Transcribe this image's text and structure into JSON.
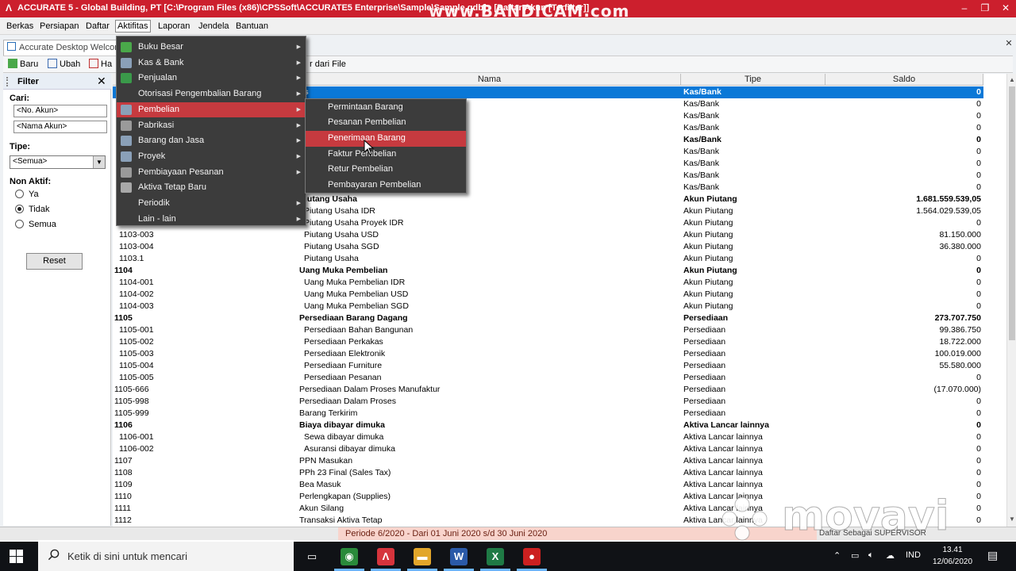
{
  "window": {
    "title": "ACCURATE 5 - Global Building, PT   [C:\\Program Files (x86)\\CPSSoft\\ACCURATE5 Enterprise\\Sample\\Sample.gdb] - [Daftar Akun [Terfilter]]",
    "recording_watermark": "www.BANDICAM.com",
    "minimize": "–",
    "restore": "❐",
    "close": "✕",
    "accent_color": "#cc1f2d"
  },
  "menubar": {
    "items": [
      "Berkas",
      "Persiapan",
      "Daftar",
      "Aktifitas",
      "Laporan",
      "Jendela",
      "Bantuan"
    ],
    "active": "Aktifitas"
  },
  "document_tab": {
    "label": "Accurate Desktop Welcome"
  },
  "toolbar": {
    "new_label": "Baru",
    "edit_label": "Ubah",
    "delete_label": "Ha",
    "import_label": "r dari File"
  },
  "filter": {
    "title": "Filter",
    "search_label": "Cari:",
    "account_no_placeholder": "<No. Akun>",
    "account_name_placeholder": "<Nama Akun>",
    "type_label": "Tipe:",
    "type_value": "<Semua>",
    "inactive_label": "Non Aktif:",
    "options": [
      "Ya",
      "Tidak",
      "Semua"
    ],
    "selected_option": "Tidak",
    "reset_label": "Reset"
  },
  "grid": {
    "columns": [
      "Nama",
      "Tipe",
      "Saldo"
    ],
    "rows": [
      {
        "no": "",
        "nama": "as",
        "tipe": "Kas/Bank",
        "saldo": "0",
        "bold": true,
        "selected": true,
        "sub": false
      },
      {
        "no": "",
        "nama": "",
        "tipe": "Kas/Bank",
        "saldo": "0",
        "bold": false,
        "selected": false,
        "sub": true
      },
      {
        "no": "",
        "nama": "",
        "tipe": "Kas/Bank",
        "saldo": "0",
        "bold": false,
        "selected": false,
        "sub": true
      },
      {
        "no": "",
        "nama": "",
        "tipe": "Kas/Bank",
        "saldo": "0",
        "bold": false,
        "selected": false,
        "sub": true
      },
      {
        "no": "",
        "nama": "",
        "tipe": "Kas/Bank",
        "saldo": "0",
        "bold": true,
        "selected": false,
        "sub": false
      },
      {
        "no": "",
        "nama": "",
        "tipe": "Kas/Bank",
        "saldo": "0",
        "bold": false,
        "selected": false,
        "sub": true
      },
      {
        "no": "",
        "nama": "",
        "tipe": "Kas/Bank",
        "saldo": "0",
        "bold": false,
        "selected": false,
        "sub": true
      },
      {
        "no": "",
        "nama": "",
        "tipe": "Kas/Bank",
        "saldo": "0",
        "bold": false,
        "selected": false,
        "sub": true
      },
      {
        "no": "",
        "nama": "",
        "tipe": "Kas/Bank",
        "saldo": "0",
        "bold": false,
        "selected": false,
        "sub": true
      },
      {
        "no": "",
        "nama": "Piutang Usaha",
        "tipe": "Akun Piutang",
        "saldo": "1.681.559.539,05",
        "bold": true,
        "selected": false,
        "sub": false
      },
      {
        "no": "",
        "nama": "Piutang Usaha IDR",
        "tipe": "Akun Piutang",
        "saldo": "1.564.029.539,05",
        "bold": false,
        "selected": false,
        "sub": true
      },
      {
        "no": "",
        "nama": "Piutang Usaha Proyek IDR",
        "tipe": "Akun Piutang",
        "saldo": "0",
        "bold": false,
        "selected": false,
        "sub": true
      },
      {
        "no": "1103-003",
        "nama": "Piutang Usaha USD",
        "tipe": "Akun Piutang",
        "saldo": "81.150.000",
        "bold": false,
        "selected": false,
        "sub": true
      },
      {
        "no": "1103-004",
        "nama": "Piutang Usaha SGD",
        "tipe": "Akun Piutang",
        "saldo": "36.380.000",
        "bold": false,
        "selected": false,
        "sub": true
      },
      {
        "no": "1103.1",
        "nama": "Piutang Usaha",
        "tipe": "Akun Piutang",
        "saldo": "0",
        "bold": false,
        "selected": false,
        "sub": true
      },
      {
        "no": "1104",
        "nama": "Uang Muka Pembelian",
        "tipe": "Akun Piutang",
        "saldo": "0",
        "bold": true,
        "selected": false,
        "sub": false
      },
      {
        "no": "1104-001",
        "nama": "Uang Muka Pembelian IDR",
        "tipe": "Akun Piutang",
        "saldo": "0",
        "bold": false,
        "selected": false,
        "sub": true
      },
      {
        "no": "1104-002",
        "nama": "Uang Muka Pembelian USD",
        "tipe": "Akun Piutang",
        "saldo": "0",
        "bold": false,
        "selected": false,
        "sub": true
      },
      {
        "no": "1104-003",
        "nama": "Uang Muka Pembelian SGD",
        "tipe": "Akun Piutang",
        "saldo": "0",
        "bold": false,
        "selected": false,
        "sub": true
      },
      {
        "no": "1105",
        "nama": "Persediaan Barang Dagang",
        "tipe": "Persediaan",
        "saldo": "273.707.750",
        "bold": true,
        "selected": false,
        "sub": false
      },
      {
        "no": "1105-001",
        "nama": "Persediaan Bahan Bangunan",
        "tipe": "Persediaan",
        "saldo": "99.386.750",
        "bold": false,
        "selected": false,
        "sub": true
      },
      {
        "no": "1105-002",
        "nama": "Persediaan Perkakas",
        "tipe": "Persediaan",
        "saldo": "18.722.000",
        "bold": false,
        "selected": false,
        "sub": true
      },
      {
        "no": "1105-003",
        "nama": "Persediaan Elektronik",
        "tipe": "Persediaan",
        "saldo": "100.019.000",
        "bold": false,
        "selected": false,
        "sub": true
      },
      {
        "no": "1105-004",
        "nama": "Persediaan Furniture",
        "tipe": "Persediaan",
        "saldo": "55.580.000",
        "bold": false,
        "selected": false,
        "sub": true
      },
      {
        "no": "1105-005",
        "nama": "Persediaan Pesanan",
        "tipe": "Persediaan",
        "saldo": "0",
        "bold": false,
        "selected": false,
        "sub": true
      },
      {
        "no": "1105-666",
        "nama": "Persediaan Dalam Proses Manufaktur",
        "tipe": "Persediaan",
        "saldo": "(17.070.000)",
        "bold": false,
        "selected": false,
        "sub": false
      },
      {
        "no": "1105-998",
        "nama": "Persediaan Dalam Proses",
        "tipe": "Persediaan",
        "saldo": "0",
        "bold": false,
        "selected": false,
        "sub": false
      },
      {
        "no": "1105-999",
        "nama": "Barang Terkirim",
        "tipe": "Persediaan",
        "saldo": "0",
        "bold": false,
        "selected": false,
        "sub": false
      },
      {
        "no": "1106",
        "nama": "Biaya dibayar dimuka",
        "tipe": "Aktiva Lancar lainnya",
        "saldo": "0",
        "bold": true,
        "selected": false,
        "sub": false
      },
      {
        "no": "1106-001",
        "nama": "Sewa dibayar dimuka",
        "tipe": "Aktiva Lancar lainnya",
        "saldo": "0",
        "bold": false,
        "selected": false,
        "sub": true
      },
      {
        "no": "1106-002",
        "nama": "Asuransi dibayar dimuka",
        "tipe": "Aktiva Lancar lainnya",
        "saldo": "0",
        "bold": false,
        "selected": false,
        "sub": true
      },
      {
        "no": "1107",
        "nama": "PPN Masukan",
        "tipe": "Aktiva Lancar lainnya",
        "saldo": "0",
        "bold": false,
        "selected": false,
        "sub": false
      },
      {
        "no": "1108",
        "nama": "PPh 23 Final (Sales Tax)",
        "tipe": "Aktiva Lancar lainnya",
        "saldo": "0",
        "bold": false,
        "selected": false,
        "sub": false
      },
      {
        "no": "1109",
        "nama": "Bea Masuk",
        "tipe": "Aktiva Lancar lainnya",
        "saldo": "0",
        "bold": false,
        "selected": false,
        "sub": false
      },
      {
        "no": "1110",
        "nama": "Perlengkapan (Supplies)",
        "tipe": "Aktiva Lancar lainnya",
        "saldo": "0",
        "bold": false,
        "selected": false,
        "sub": false
      },
      {
        "no": "1111",
        "nama": "Akun Silang",
        "tipe": "Aktiva Lancar lainnya",
        "saldo": "0",
        "bold": false,
        "selected": false,
        "sub": false
      },
      {
        "no": "1112",
        "nama": "Transaksi Aktiva Tetap",
        "tipe": "Aktiva Lancar lainnya",
        "saldo": "0",
        "bold": false,
        "selected": false,
        "sub": false
      }
    ]
  },
  "statusbar": {
    "period": "Periode 6/2020 - Dari 01 Juni 2020 s/d 30 Juni 2020",
    "user": "Daftar Sebagai SUPERVISOR"
  },
  "watermark_movavi": "movavi",
  "aktifitas_menu": {
    "items": [
      {
        "label": "Buku Besar",
        "submenu": true,
        "icon_color": "#4aa84a"
      },
      {
        "label": "Kas & Bank",
        "submenu": true,
        "icon_color": "#8aa0b8"
      },
      {
        "label": "Penjualan",
        "submenu": true,
        "icon_color": "#3a9a4a"
      },
      {
        "label": "Otorisasi Pengembalian Barang",
        "submenu": true,
        "icon_color": ""
      },
      {
        "label": "Pembelian",
        "submenu": true,
        "icon_color": "#8aa0b8"
      },
      {
        "label": "Pabrikasi",
        "submenu": true,
        "icon_color": "#9a9a9a"
      },
      {
        "label": "Barang dan Jasa",
        "submenu": true,
        "icon_color": "#8aa0b8"
      },
      {
        "label": "Proyek",
        "submenu": true,
        "icon_color": "#8aa0b8"
      },
      {
        "label": "Pembiayaan Pesanan",
        "submenu": true,
        "icon_color": "#9a9a9a"
      },
      {
        "label": "Aktiva Tetap Baru",
        "submenu": false,
        "icon_color": "#a8a8a8"
      },
      {
        "label": "Periodik",
        "submenu": true,
        "icon_color": ""
      },
      {
        "label": "Lain - lain",
        "submenu": true,
        "icon_color": ""
      }
    ],
    "highlighted": "Pembelian"
  },
  "pembelian_submenu": {
    "items": [
      "Permintaan Barang",
      "Pesanan Pembelian",
      "Penerimaan Barang",
      "Faktur Pembelian",
      "Retur Pembelian",
      "Pembayaran Pembelian"
    ],
    "highlighted": "Penerimaan Barang"
  },
  "taskbar": {
    "search_placeholder": "Ketik di sini untuk mencari",
    "apps": [
      {
        "name": "task-view",
        "glyph": "▭",
        "color": "#101216"
      },
      {
        "name": "chrome",
        "glyph": "◉",
        "color": "#2a8a3a"
      },
      {
        "name": "accurate",
        "glyph": "Λ",
        "color": "#d6343c"
      },
      {
        "name": "file-explorer",
        "glyph": "▬",
        "color": "#e2a62a"
      },
      {
        "name": "word",
        "glyph": "W",
        "color": "#2b5aa8"
      },
      {
        "name": "excel",
        "glyph": "X",
        "color": "#1f7a45"
      },
      {
        "name": "recorder",
        "glyph": "●",
        "color": "#cc2020"
      }
    ],
    "language": "IND",
    "time": "13.41",
    "date": "12/06/2020"
  }
}
